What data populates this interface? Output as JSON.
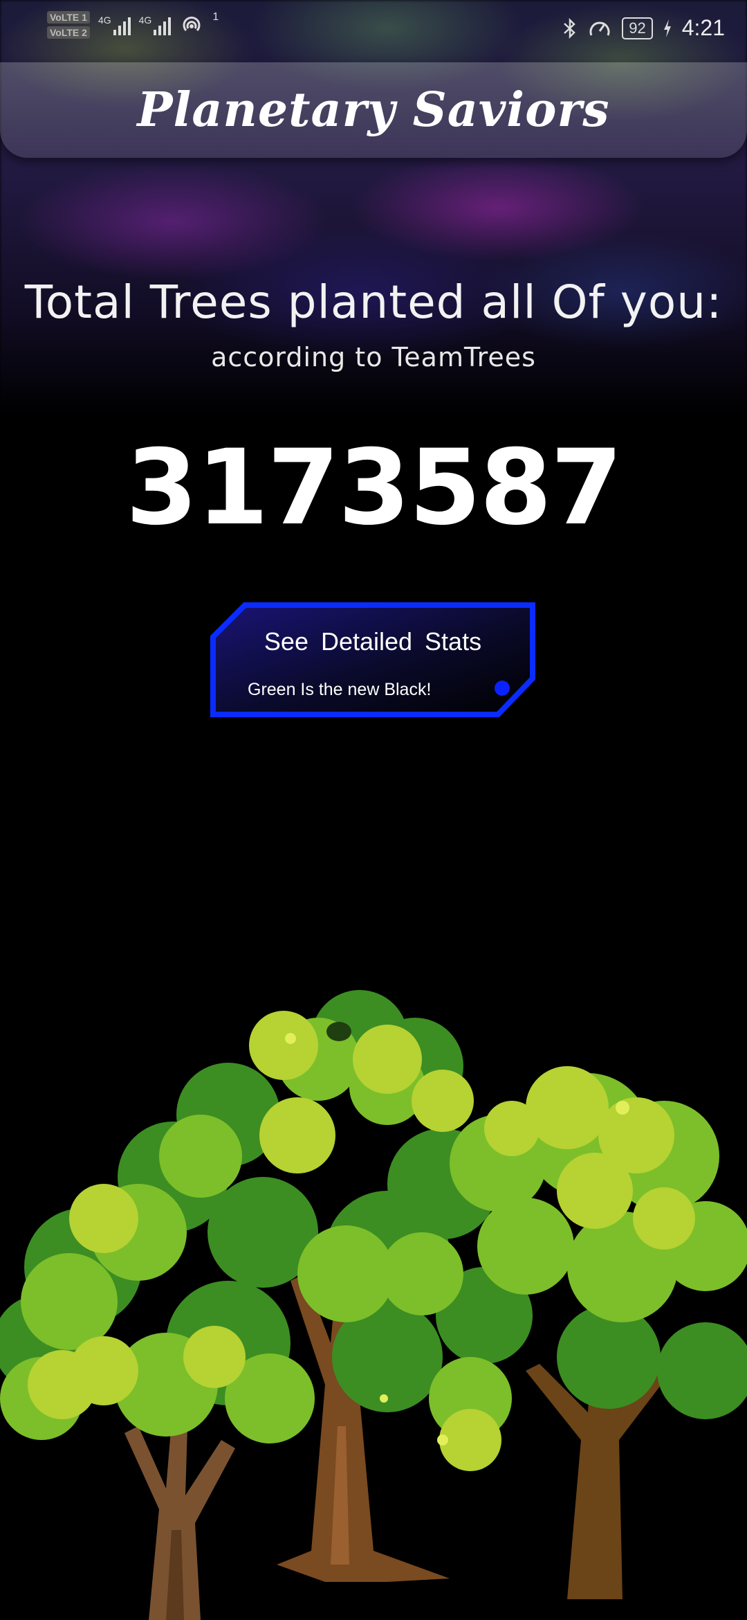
{
  "status_bar": {
    "volte1": "VoLTE 1",
    "volte2": "VoLTE 2",
    "net1": "4G",
    "net2": "4G",
    "hotspot_count": "1",
    "battery": "92",
    "time": "4:21"
  },
  "header": {
    "title": "Planetary Saviors"
  },
  "main": {
    "headline": "Total Trees planted all Of you:",
    "subline": "according to TeamTrees",
    "count": "3173587"
  },
  "stats_button": {
    "label": "See  Detailed Stats",
    "tagline": "Green Is the new Black!",
    "accent": "#0a2cff"
  },
  "illustration": {
    "name": "trees-illustration",
    "colors": {
      "leaf_light": "#b6d233",
      "leaf_mid": "#7cbf2a",
      "leaf_dark": "#3c8e22",
      "trunk": "#7a4a20"
    }
  }
}
